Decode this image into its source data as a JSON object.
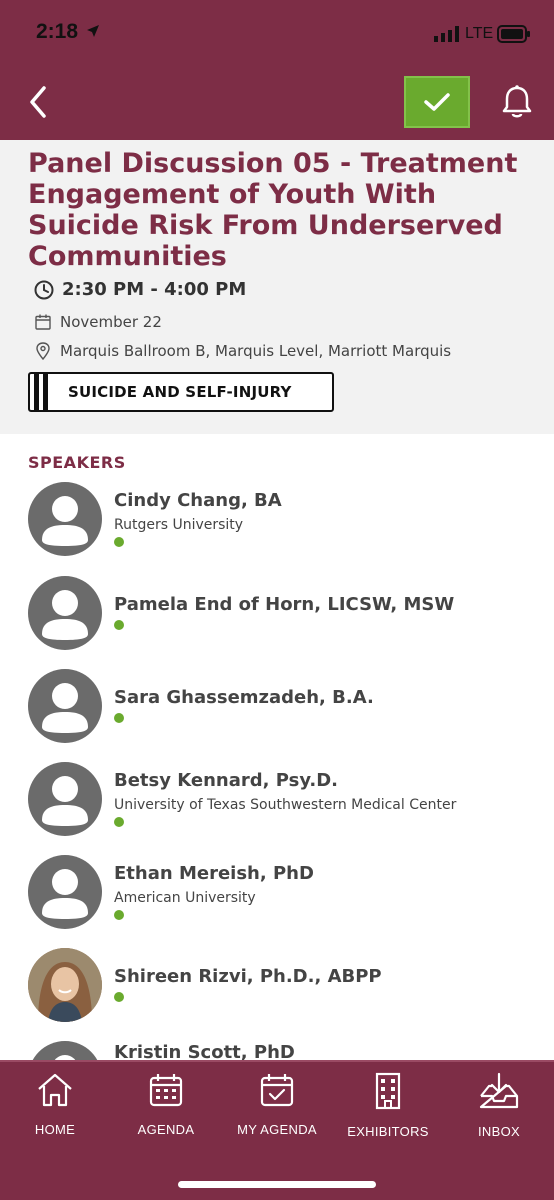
{
  "status_bar": {
    "time": "2:18",
    "network": "LTE"
  },
  "header": {
    "accent": "#7d2d46",
    "check_color": "#6aaa2e"
  },
  "session": {
    "title": "Panel Discussion 05 - Treatment Engagement of Youth With Suicide Risk From Underserved Communities",
    "time": "2:30 PM - 4:00 PM",
    "date": "November 22",
    "location": "Marquis Ballroom B, Marquis Level, Marriott Marquis",
    "track": "SUICIDE AND SELF-INJURY"
  },
  "speakers_heading": "SPEAKERS",
  "speakers": [
    {
      "name": "Cindy Chang, BA",
      "org": "Rutgers University"
    },
    {
      "name": "Pamela End of Horn, LICSW, MSW",
      "org": ""
    },
    {
      "name": "Sara Ghassemzadeh, B.A.",
      "org": ""
    },
    {
      "name": "Betsy Kennard, Psy.D.",
      "org": "University of Texas Southwestern Medical Center"
    },
    {
      "name": "Ethan Mereish, PhD",
      "org": "American University"
    },
    {
      "name": "Shireen Rizvi, Ph.D., ABPP",
      "org": ""
    },
    {
      "name": "Kristin Scott, PhD",
      "org": ""
    }
  ],
  "tabs": [
    {
      "label": "HOME",
      "icon": "home-icon"
    },
    {
      "label": "AGENDA",
      "icon": "calendar-icon"
    },
    {
      "label": "MY AGENDA",
      "icon": "calendar-check-icon"
    },
    {
      "label": "EXHIBITORS",
      "icon": "building-icon"
    },
    {
      "label": "INBOX",
      "icon": "inbox-icon"
    }
  ]
}
